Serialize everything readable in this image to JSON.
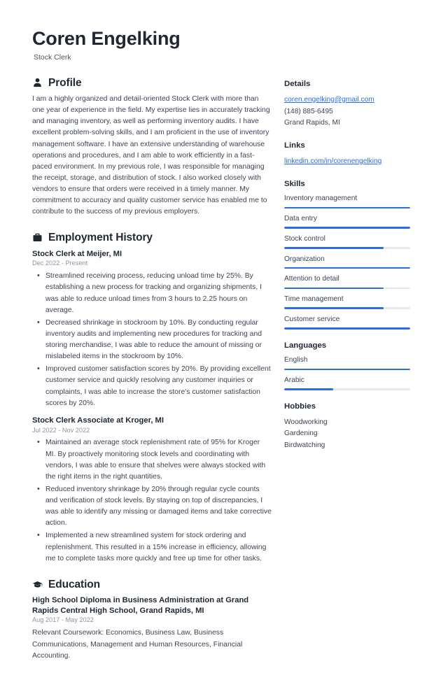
{
  "header": {
    "full_name": "Coren Engelking",
    "job_title": "Stock Clerk"
  },
  "colors": {
    "accent": "#2b6ce8",
    "text": "#3b4453",
    "heading": "#1f2733",
    "muted": "#8c93a1",
    "track": "#e6e8ec"
  },
  "main": {
    "profile": {
      "icon": "user-icon",
      "title": "Profile",
      "text": "I am a highly organized and detail-oriented Stock Clerk with more than one year of experience in the field. My expertise lies in accurately tracking and managing inventory, as well as performing inventory audits. I have excellent problem-solving skills, and I am proficient in the use of inventory management software. I have an extensive understanding of warehouse operations and procedures, and I am able to work efficiently in a fast-paced environment. In my previous role, I was responsible for managing the receipt, storage, and distribution of stock. I also worked closely with vendors to ensure that orders were received in a timely manner. My commitment to accuracy and quality customer service has enabled me to contribute to the success of my previous employers."
    },
    "employment": {
      "icon": "briefcase-icon",
      "title": "Employment History",
      "entries": [
        {
          "title": "Stock Clerk at Meijer, MI",
          "date": "Dec 2022 - Present",
          "bullets": [
            "Streamlined receiving process, reducing unload time by 25%. By establishing a new process for tracking and organizing shipments, I was able to reduce unload times from 3 hours to 2.25 hours on average.",
            "Decreased shrinkage in stockroom by 10%. By conducting regular inventory audits and implementing new procedures for tracking and storing merchandise, I was able to reduce the amount of missing or mislabeled items in the stockroom by 10%.",
            "Improved customer satisfaction scores by 20%. By providing excellent customer service and quickly resolving any customer inquiries or complaints, I was able to increase the store's customer satisfaction scores by 20%."
          ]
        },
        {
          "title": "Stock Clerk Associate at Kroger, MI",
          "date": "Jul 2022 - Nov 2022",
          "bullets": [
            "Maintained an average stock replenishment rate of 95% for Kroger MI. By proactively monitoring stock levels and coordinating with vendors, I was able to ensure that shelves were always stocked with the right items in the right quantities.",
            "Reduced inventory shrinkage by 20% through regular cycle counts and verification of stock levels. By staying on top of discrepancies, I was able to identify any missing or damaged items and take corrective action.",
            "Implemented a new streamlined system for stock ordering and replenishment. This resulted in a 15% increase in efficiency, allowing me to complete tasks more quickly and free up time for other tasks."
          ]
        }
      ]
    },
    "education": {
      "icon": "graduation-cap-icon",
      "title": "Education",
      "entries": [
        {
          "title": "High School Diploma in Business Administration at Grand Rapids Central High School, Grand Rapids, MI",
          "date": "Aug 2017 - May 2022",
          "note": "Relevant Coursework: Economics, Business Law, Business Communications, Management and Human Resources, Financial Accounting."
        }
      ]
    }
  },
  "sidebar": {
    "details": {
      "title": "Details",
      "email": "coren.engelking@gmail.com",
      "phone": "(148) 885-6495",
      "location": "Grand Rapids, MI"
    },
    "links": {
      "title": "Links",
      "items": [
        {
          "label": "linkedin.com/in/corenengelking"
        }
      ]
    },
    "skills": {
      "title": "Skills",
      "items": [
        {
          "label": "Inventory management",
          "level": 100
        },
        {
          "label": "Data entry",
          "level": 100
        },
        {
          "label": "Stock control",
          "level": 79
        },
        {
          "label": "Organization",
          "level": 100
        },
        {
          "label": "Attention to detail",
          "level": 79
        },
        {
          "label": "Time management",
          "level": 79
        },
        {
          "label": "Customer service",
          "level": 100
        }
      ]
    },
    "languages": {
      "title": "Languages",
      "items": [
        {
          "label": "English",
          "level": 100
        },
        {
          "label": "Arabic",
          "level": 39
        }
      ]
    },
    "hobbies": {
      "title": "Hobbies",
      "items": [
        {
          "label": "Woodworking"
        },
        {
          "label": "Gardening"
        },
        {
          "label": "Birdwatching"
        }
      ]
    }
  }
}
